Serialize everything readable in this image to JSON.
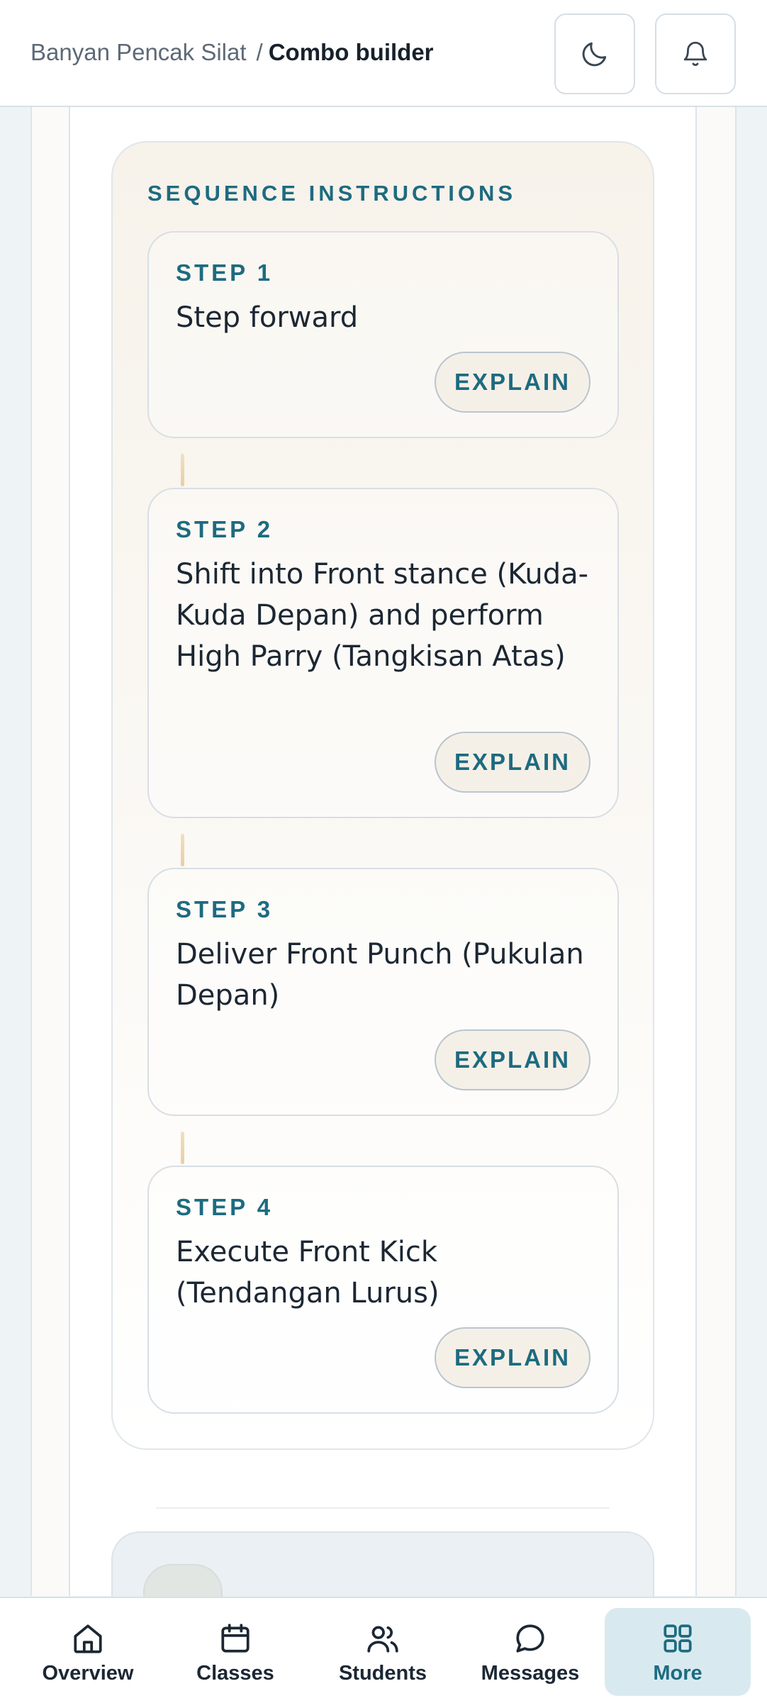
{
  "header": {
    "breadcrumb_parent": "Banyan Pencak Silat",
    "breadcrumb_separator": "/",
    "breadcrumb_current": "Combo builder",
    "theme_icon": "moon-icon",
    "notifications_icon": "bell-icon"
  },
  "sequence": {
    "title": "SEQUENCE INSTRUCTIONS",
    "steps": [
      {
        "label": "STEP 1",
        "text": "Step forward",
        "button": "EXPLAIN"
      },
      {
        "label": "STEP 2",
        "text": "Shift into Front stance (Kuda-Kuda Depan) and perform High Parry (Tangkisan Atas)",
        "button": "EXPLAIN"
      },
      {
        "label": "STEP 3",
        "text": "Deliver Front Punch (Pukulan Depan)",
        "button": "EXPLAIN"
      },
      {
        "label": "STEP 4",
        "text": "Execute Front Kick (Tendangan Lurus)",
        "button": "EXPLAIN"
      }
    ]
  },
  "nav": {
    "items": [
      {
        "label": "Overview",
        "icon": "home-icon",
        "active": false
      },
      {
        "label": "Classes",
        "icon": "calendar-icon",
        "active": false
      },
      {
        "label": "Students",
        "icon": "users-icon",
        "active": false
      },
      {
        "label": "Messages",
        "icon": "chat-icon",
        "active": false
      },
      {
        "label": "More",
        "icon": "grid-icon",
        "active": true
      }
    ]
  },
  "colors": {
    "accent": "#1d6b80",
    "active_nav_bg": "#d8eaef",
    "panel_warm": "#f7f2ea"
  }
}
